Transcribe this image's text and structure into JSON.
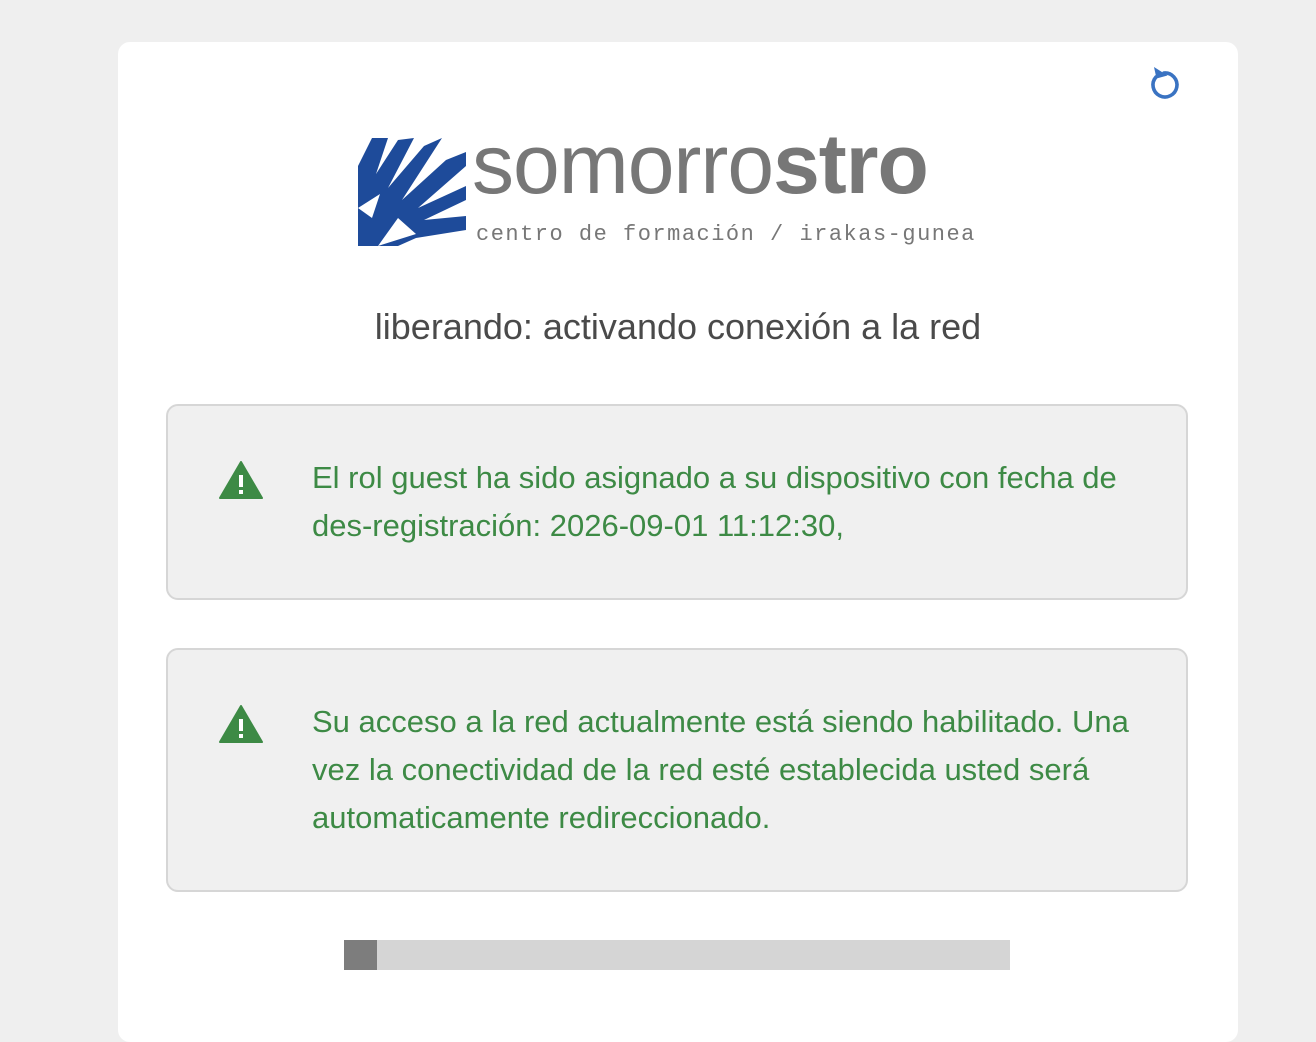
{
  "header": {
    "refresh_icon": "refresh-icon"
  },
  "logo": {
    "mark_icon": "somorrostro-leaf-logo",
    "word_light": "somorro",
    "word_bold": "stro",
    "subtitle": "centro de formación / irakas-gunea",
    "brand_color": "#1e4b9a",
    "text_color": "#777777"
  },
  "status": {
    "heading": "liberando: activando conexión a la red"
  },
  "alerts": [
    {
      "icon": "warning-icon",
      "text": "El rol guest ha sido asignado a su dispositivo con fecha de des-registración: 2026-09-01 11:12:30,"
    },
    {
      "icon": "warning-icon",
      "text": "Su acceso a la red actualmente está siendo habilitado. Una vez la conectividad de la red esté establecida usted será automaticamente redireccionado."
    }
  ],
  "progress": {
    "fraction": 0.05
  },
  "colors": {
    "accent": "#3a73c2",
    "success_text": "#3d8a45",
    "warning_icon": "#3d8a45",
    "progress_track": "#d5d5d5",
    "progress_fill": "#7d7d7d"
  }
}
